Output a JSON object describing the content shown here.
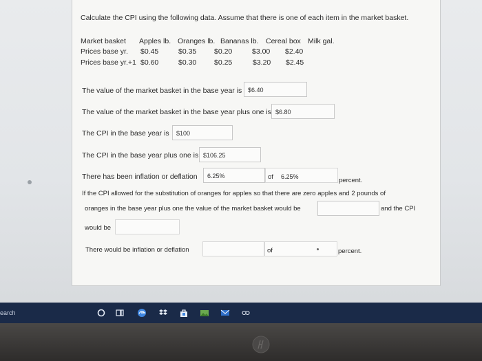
{
  "intro": "Calculate the CPI using the following data. Assume that there is one of each item in the market basket.",
  "table": {
    "headers": [
      "Market basket",
      "Apples lb.",
      "Oranges lb.",
      "Bananas lb.",
      "Cereal box",
      "Milk gal."
    ],
    "rows": [
      {
        "label": "Prices base yr.",
        "values": [
          "$0.45",
          "$0.35",
          "$0.20",
          "$3.00",
          "$2.40"
        ]
      },
      {
        "label": "Prices base yr.+1",
        "values": [
          "$0.60",
          "$0.30",
          "$0.25",
          "$3.20",
          "$2.45"
        ]
      }
    ]
  },
  "questions": {
    "q1": {
      "label": "The value of the market basket in the base year is",
      "value": "$6.40"
    },
    "q2": {
      "label": "The value of the market basket in the base year plus one is",
      "value": "$6.80"
    },
    "q3": {
      "label": "The CPI in the base year is",
      "value": "$100"
    },
    "q4": {
      "label": "The CPI in the base year plus one is",
      "value": "$106.25"
    },
    "q5": {
      "label": "There has been inflation or deflation",
      "value": "6.25%",
      "of_label": "of",
      "of_value": "6.25%",
      "suffix": "percent."
    },
    "q6": {
      "line1": "If the CPI allowed for the substitution of oranges for apples so that there are zero apples and 2 pounds of",
      "line2": "oranges in the base year plus one the value of the market basket would be",
      "after": "and the CPI",
      "line3": "would be",
      "value1": "",
      "value2": ""
    },
    "q7": {
      "label": "There would be inflation or deflation",
      "of_label": "of",
      "suffix": "percent."
    }
  },
  "taskbar": {
    "search": "earch"
  }
}
